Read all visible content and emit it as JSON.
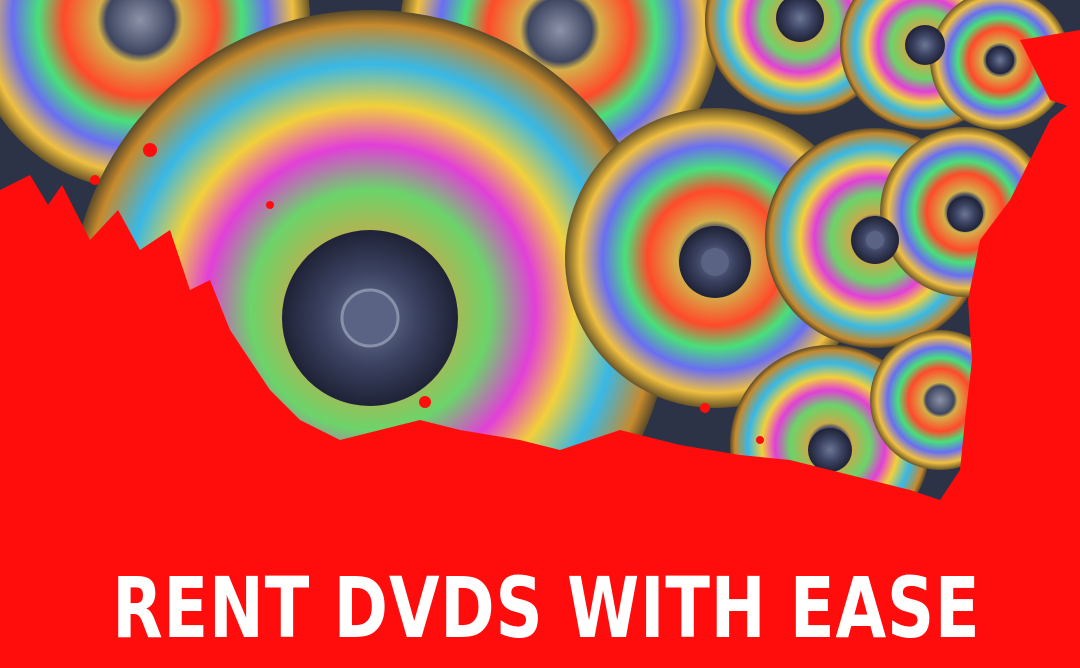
{
  "headline": "RENT DVDS WITH EASE",
  "image": {
    "subject": "dvd-discs-photo",
    "background_color": "#ff0d0d"
  }
}
